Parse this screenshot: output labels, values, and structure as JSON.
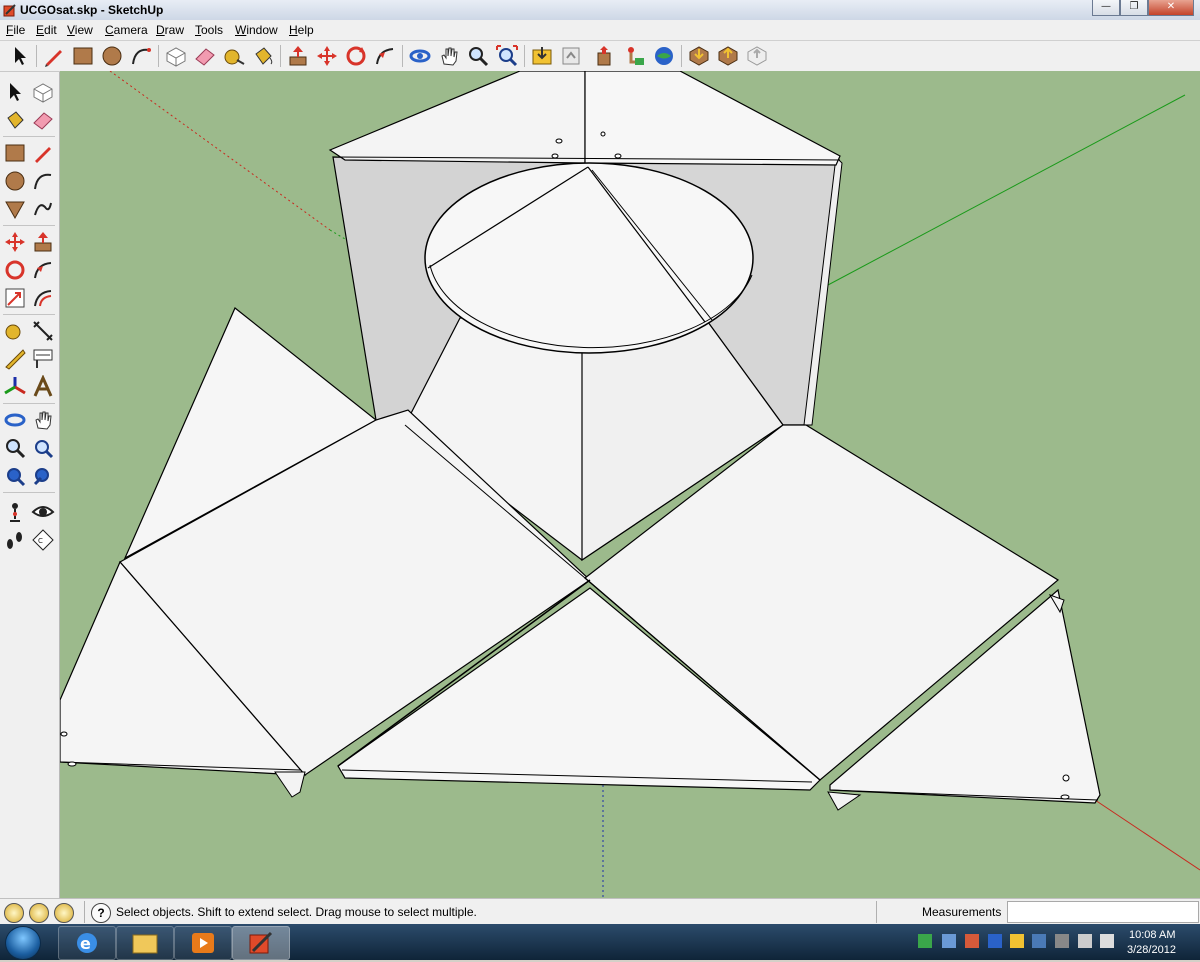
{
  "window": {
    "title": "UCGOsat.skp - SketchUp",
    "buttons": [
      "0",
      "1",
      "r"
    ]
  },
  "menubar": {
    "items": [
      "File",
      "Edit",
      "View",
      "Camera",
      "Draw",
      "Tools",
      "Window",
      "Help"
    ]
  },
  "toolbar": {
    "tools": [
      "select",
      "pencil",
      "rectangle",
      "circle",
      "arc",
      "make-component",
      "eraser",
      "tape-measure",
      "paint-bucket",
      "push-pull",
      "move",
      "rotate",
      "follow-me",
      "orbit",
      "pan",
      "zoom",
      "zoom-extents",
      "previous-view",
      "next-view",
      "get-models",
      "share-model",
      "share-component",
      "get-photo-texture",
      "preview-google-earth",
      "place-model"
    ]
  },
  "sidebar": {
    "tools": [
      "select",
      "make-component",
      "paint-bucket",
      "eraser",
      "rectangle",
      "line",
      "circle",
      "arc",
      "polygon",
      "freehand",
      "move",
      "push-pull",
      "rotate",
      "follow-me",
      "scale",
      "offset",
      "tape-measure",
      "dimension",
      "protractor",
      "text",
      "axes",
      "3d-text",
      "orbit",
      "pan",
      "zoom",
      "zoom-window",
      "zoom-extents",
      "previous",
      "position-camera",
      "look-around",
      "walk",
      "section-plane"
    ]
  },
  "statusbar": {
    "message": "Select objects. Shift to extend select. Drag mouse to select multiple.",
    "measurements_label": "Measurements",
    "measurements_value": ""
  },
  "taskbar": {
    "time": "10:08 AM",
    "date": "3/28/2012"
  },
  "colors": {
    "viewport_bg": "#9cba8c",
    "face": "#f2f2f2",
    "edge": "#000000",
    "axis_red": "#c8281e",
    "axis_green": "#1a9a1a",
    "axis_blue": "#1c2ea8"
  }
}
